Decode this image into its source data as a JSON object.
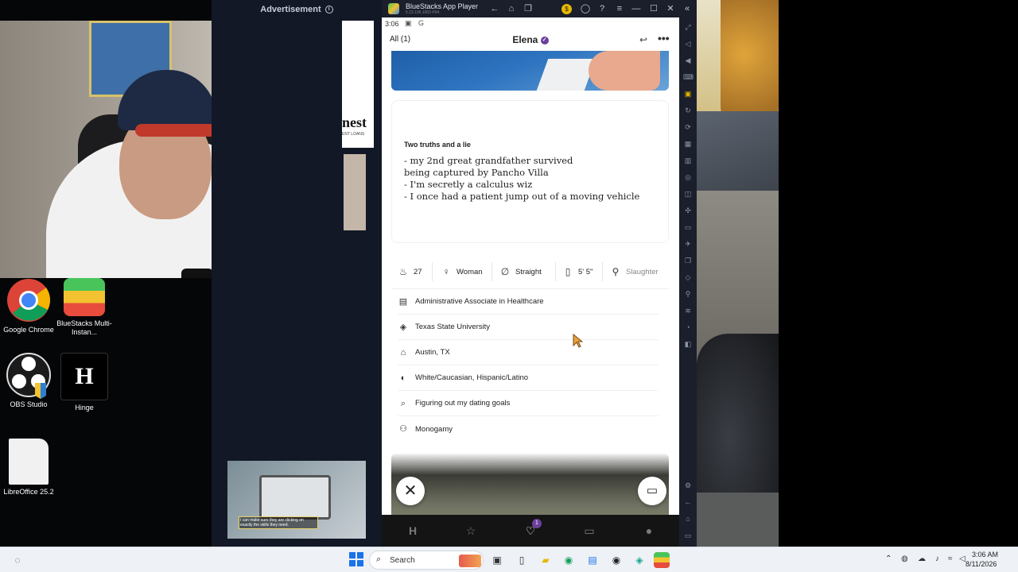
{
  "desktop": {
    "icons": [
      {
        "label": "Google Chrome"
      },
      {
        "label": "BlueStacks Multi-Instan..."
      },
      {
        "label": "OBS Studio"
      },
      {
        "label": "Hinge"
      },
      {
        "label": "LibreOffice 25.2"
      }
    ]
  },
  "ad": {
    "header": "Advertisement",
    "banner_brand": "nest",
    "banner_sub": "ENT LOANS",
    "video_caption": "I can make sure they are clicking on exactly the skills they need."
  },
  "emulator": {
    "title": "BlueStacks App Player",
    "version": "5.22.106.1003 P64",
    "buttons": {
      "back": "←",
      "home": "⌂",
      "recent": "❐",
      "coin": "$",
      "account": "◯",
      "help": "?",
      "menu": "≡",
      "minimize": "—",
      "maximize": "☐",
      "close": "✕",
      "collapse": "«"
    }
  },
  "phone": {
    "status": {
      "time": "3:06",
      "icons": "▣ G"
    },
    "appbar": {
      "all_label": "All (1)",
      "profile_name": "Elena",
      "verified": "✓",
      "undo": "↩",
      "more": "•••"
    },
    "prompt": {
      "title": "Two truths and a lie",
      "answer": "- my 2nd great grandfather survived\nbeing captured by Pancho Villa\n- I'm secretly a calculus wiz\n- I once had a patient jump out of a moving vehicle"
    },
    "chips": [
      {
        "icon": "age-icon",
        "glyph": "♨",
        "label": "27"
      },
      {
        "icon": "gender-icon",
        "glyph": "♀",
        "label": "Woman"
      },
      {
        "icon": "orientation-icon",
        "glyph": "∅",
        "label": "Straight"
      },
      {
        "icon": "height-icon",
        "glyph": "▯",
        "label": "5' 5\""
      },
      {
        "icon": "location-pin-icon",
        "glyph": "⚲",
        "label": "Slaughter"
      }
    ],
    "details": [
      {
        "icon": "briefcase-icon",
        "glyph": "▤",
        "label": "Administrative Associate in Healthcare"
      },
      {
        "icon": "graduation-cap-icon",
        "glyph": "◈",
        "label": "Texas State University"
      },
      {
        "icon": "house-icon",
        "glyph": "⌂",
        "label": "Austin, TX"
      },
      {
        "icon": "ethnicity-icon",
        "glyph": "◐",
        "label": "White/Caucasian, Hispanic/Latino"
      },
      {
        "icon": "search-icon",
        "glyph": "⌕",
        "label": "Figuring out my dating goals"
      },
      {
        "icon": "relationship-icon",
        "glyph": "⚇",
        "label": "Monogamy"
      }
    ],
    "fab": {
      "skip": "✕",
      "comment": "▭"
    },
    "nav": [
      {
        "name": "nav-discover-icon",
        "glyph": "H"
      },
      {
        "name": "nav-standouts-icon",
        "glyph": "☆"
      },
      {
        "name": "nav-likes-icon",
        "glyph": "♡",
        "badge": "1"
      },
      {
        "name": "nav-matches-icon",
        "glyph": "▭"
      },
      {
        "name": "nav-profile-icon",
        "glyph": "●"
      }
    ]
  },
  "taskbar": {
    "search_placeholder": "Search",
    "time": "3:06 AM",
    "date": "8/11/2026"
  }
}
